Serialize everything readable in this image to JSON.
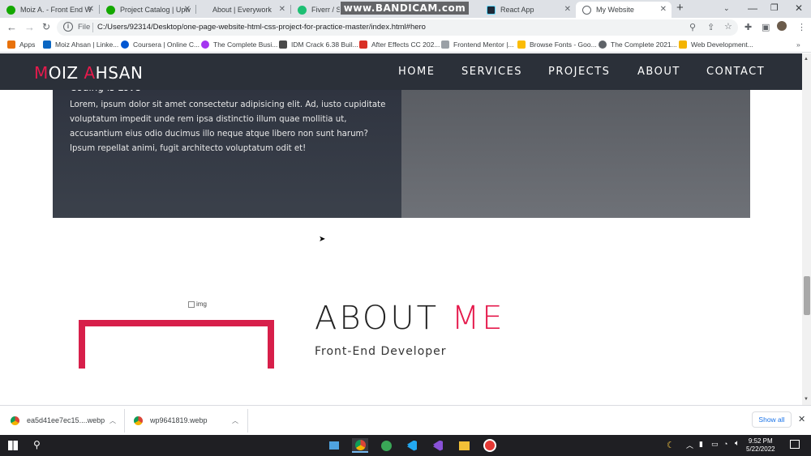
{
  "browser": {
    "tabs": [
      {
        "label": "Moiz A. - Front End W",
        "icon": "upwork-icon",
        "color": "#14a800"
      },
      {
        "label": "Project Catalog | Upw",
        "icon": "upwork-icon",
        "color": "#14a800"
      },
      {
        "label": "About | Everywork",
        "icon": "",
        "color": ""
      },
      {
        "label": "Fiverr / Sear",
        "icon": "fiverr-icon",
        "color": "#1dbf73"
      },
      {
        "label": "React App",
        "icon": "react-icon",
        "color": "#61dafb"
      },
      {
        "label": "My Website",
        "icon": "globe-icon",
        "color": "#5f6368"
      }
    ],
    "recorder_watermark": "www.BANDICAM.com",
    "address": {
      "scheme_label": "File",
      "url": "C:/Users/92314/Desktop/one-page-website-html-css-project-for-practice-master/index.html#hero"
    },
    "bookmarks": [
      {
        "label": "Apps",
        "icon": "apps-grid-icon",
        "color": "#e8710a"
      },
      {
        "label": "Moiz Ahsan | Linke...",
        "icon": "linkedin-icon",
        "color": "#0a66c2"
      },
      {
        "label": "Coursera | Online C...",
        "icon": "coursera-icon",
        "color": "#0056d2"
      },
      {
        "label": "The Complete Busi...",
        "icon": "udemy-icon",
        "color": "#a435f0"
      },
      {
        "label": "IDM Crack 6.38 Buil...",
        "icon": "idm-icon",
        "color": "#4a4a4a"
      },
      {
        "label": "After Effects CC 202...",
        "icon": "fileshare-icon",
        "color": "#d93025"
      },
      {
        "label": "Frontend Mentor |...",
        "icon": "frontend-mentor-icon",
        "color": "#9aa0a6"
      },
      {
        "label": "Browse Fonts - Goo...",
        "icon": "google-fonts-icon",
        "color": "#fbbc04"
      },
      {
        "label": "The Complete 2021...",
        "icon": "globe-icon",
        "color": "#5f6368"
      },
      {
        "label": "Web Development...",
        "icon": "bookmark-icon",
        "color": "#f4b400"
      }
    ]
  },
  "site": {
    "brand_initial_1": "M",
    "brand_rest_1": "OIZ ",
    "brand_initial_2": "A",
    "brand_rest_2": "HSAN",
    "nav": [
      "HOME",
      "SERVICES",
      "PROJECTS",
      "ABOUT",
      "CONTACT"
    ],
    "hero_subtitle": "Coding is Love",
    "hero_text": "Lorem, ipsum dolor sit amet consectetur adipisicing elit. Ad, iusto cupiditate voluptatum impedit unde rem ipsa distinctio illum quae mollitia ut, accusantium eius odio ducimus illo neque atque libero non sunt harum? Ipsum repellat animi, fugit architecto voluptatum odit et!",
    "about_img_alt": "img",
    "about_title_1": "ABOUT",
    "about_title_2": "ME",
    "about_role": "Front-End Developer",
    "accent_color": "#e51a4c"
  },
  "downloads": {
    "items": [
      {
        "name": "ea5d41ee7ec15....webp"
      },
      {
        "name": "wp9641819.webp"
      }
    ],
    "show_all": "Show all"
  },
  "taskbar": {
    "time": "9:52 PM",
    "date": "5/22/2022"
  }
}
